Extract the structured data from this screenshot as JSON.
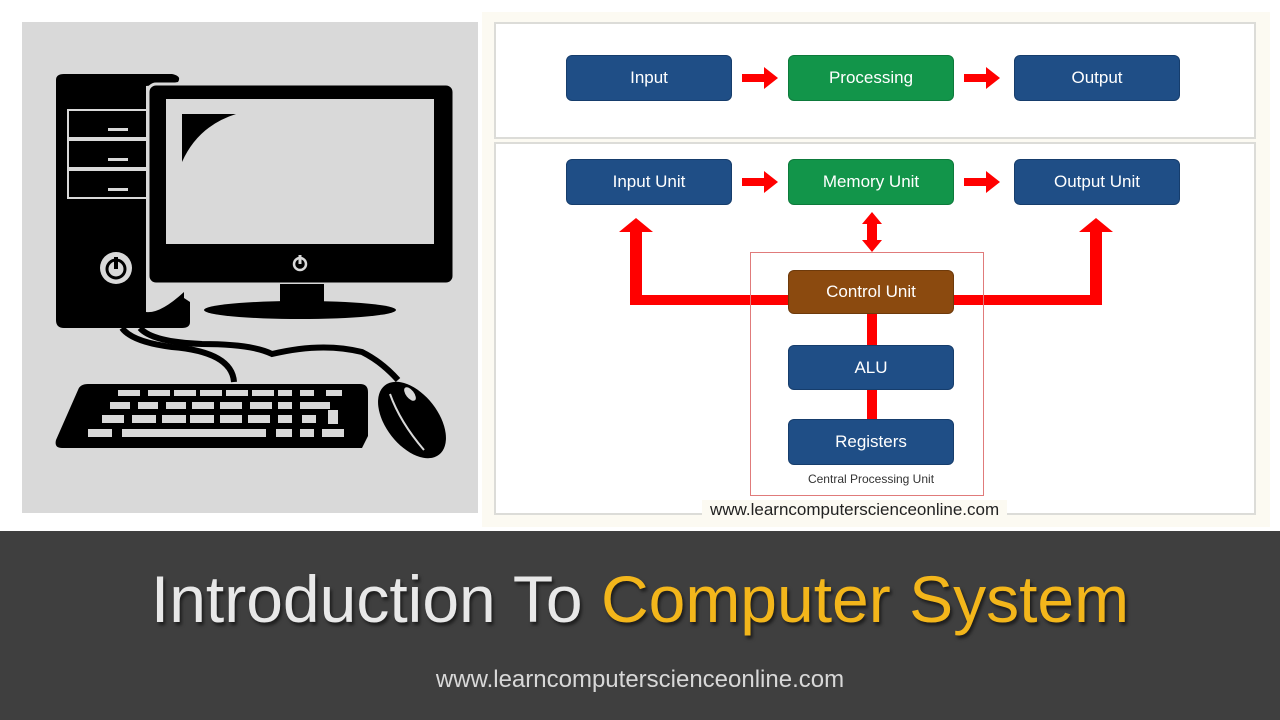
{
  "illustration": {
    "subject": "desktop-computer",
    "parts": [
      "tower",
      "monitor",
      "keyboard",
      "mouse",
      "power-button"
    ]
  },
  "diagram_top": {
    "nodes": [
      {
        "id": "input",
        "label": "Input",
        "color": "#1f4e86"
      },
      {
        "id": "processing",
        "label": "Processing",
        "color": "#12954a"
      },
      {
        "id": "output",
        "label": "Output",
        "color": "#1f4e86"
      }
    ],
    "edges": [
      [
        "input",
        "processing"
      ],
      [
        "processing",
        "output"
      ]
    ]
  },
  "diagram_bottom": {
    "nodes": [
      {
        "id": "input_unit",
        "label": "Input Unit",
        "color": "#1f4e86"
      },
      {
        "id": "memory_unit",
        "label": "Memory Unit",
        "color": "#12954a"
      },
      {
        "id": "output_unit",
        "label": "Output Unit",
        "color": "#1f4e86"
      },
      {
        "id": "control_unit",
        "label": "Control Unit",
        "color": "#8b4a0f"
      },
      {
        "id": "alu",
        "label": "ALU",
        "color": "#1f4e86"
      },
      {
        "id": "registers",
        "label": "Registers",
        "color": "#1f4e86"
      }
    ],
    "cpu_caption": "Central Processing  Unit",
    "arrow_color": "#ff0000",
    "edges": [
      [
        "input_unit",
        "memory_unit"
      ],
      [
        "memory_unit",
        "output_unit"
      ],
      [
        "memory_unit",
        "control_unit",
        "bidirectional"
      ],
      [
        "control_unit",
        "input_unit"
      ],
      [
        "control_unit",
        "output_unit"
      ],
      [
        "control_unit",
        "alu"
      ],
      [
        "alu",
        "registers"
      ]
    ]
  },
  "diagram_site": "www.learncomputerscienceonline.com",
  "banner": {
    "title_part1": "Introduction To",
    "title_part2": "Computer System",
    "title_part2_color": "#f3b61b",
    "url": "www.learncomputerscienceonline.com"
  }
}
